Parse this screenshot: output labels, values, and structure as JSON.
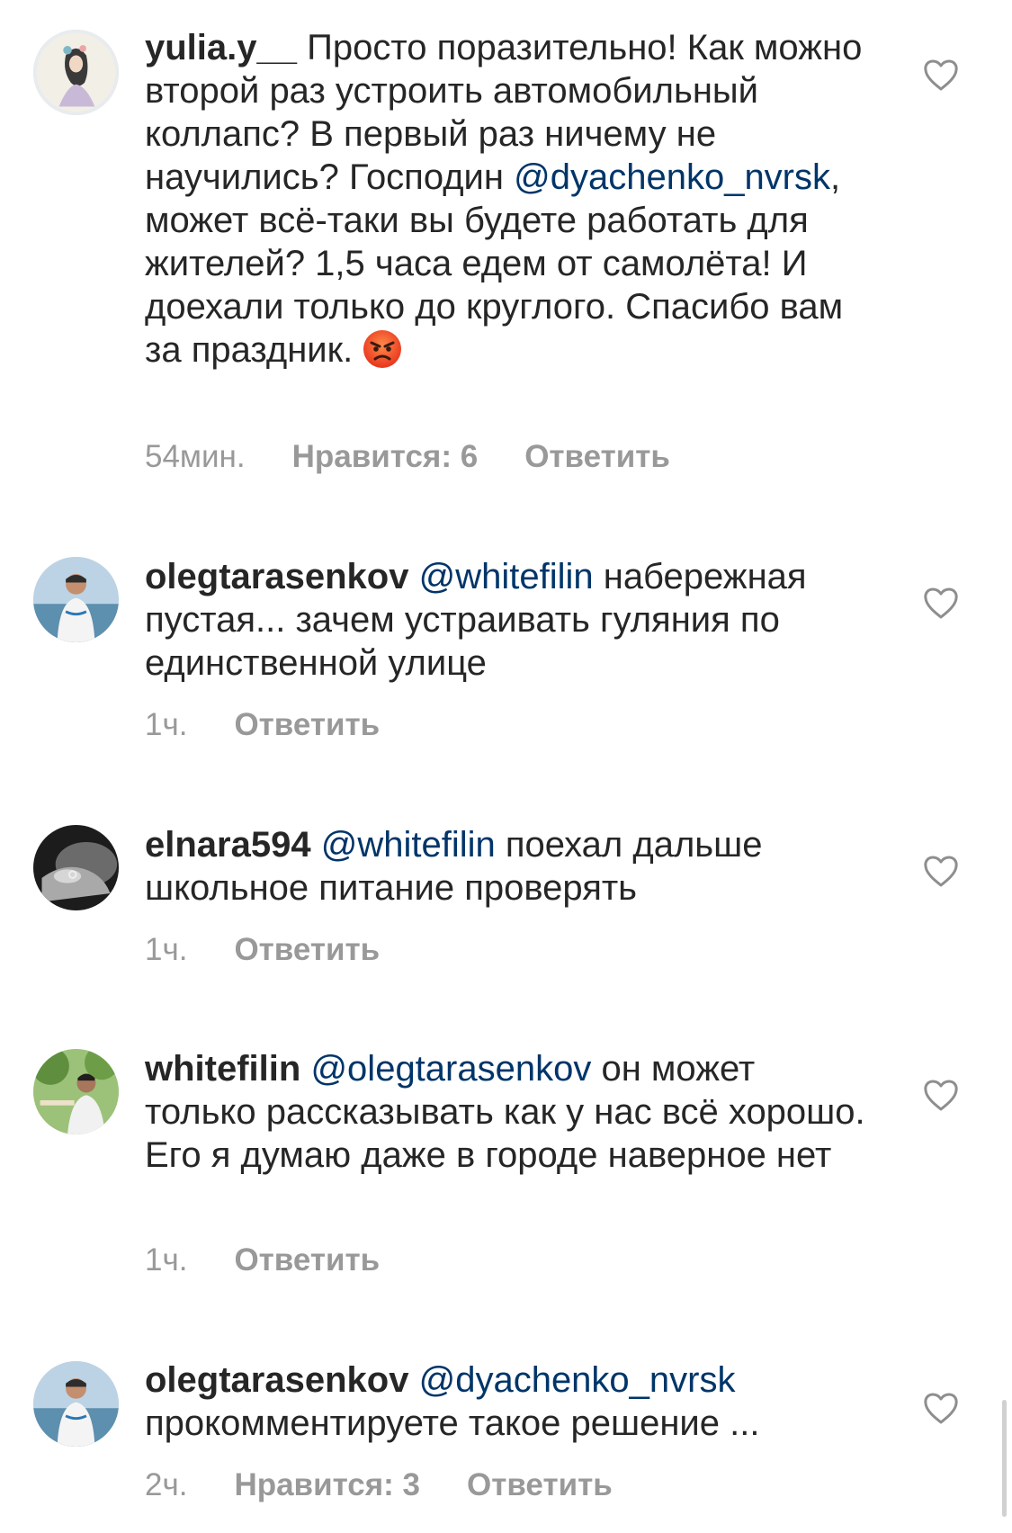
{
  "comments": [
    {
      "username": "yulia.y__",
      "text_before": " Просто поразительно! Как можно второй раз устроить автомобильный коллапс? В первый раз ничему не научились? Господин ",
      "mention": "@dyachenko_nvrsk",
      "text_after": ", может всё-таки вы будете работать для жителей? 1,5 часа едем от самолёта! И доехали только до круглого. Спасибо вам за праздник.",
      "emoji": "angry-face",
      "time": "54мин.",
      "likes": "Нравится: 6",
      "reply": "Ответить"
    },
    {
      "username": "olegtarasenkov",
      "text_before": " ",
      "mention": "@whitefilin",
      "text_after": " набережная пустая... зачем устраивать гуляния по единственной улице",
      "time": "1ч.",
      "likes": "",
      "reply": "Ответить"
    },
    {
      "username": "elnara594",
      "text_before": " ",
      "mention": "@whitefilin",
      "text_after": " поехал дальше школьное питание проверять",
      "time": "1ч.",
      "likes": "",
      "reply": "Ответить"
    },
    {
      "username": "whitefilin",
      "text_before": " ",
      "mention": "@olegtarasenkov",
      "text_after": " он может только рассказывать как у нас всё хорошо. Его я думаю даже в городе наверное нет",
      "time": "1ч.",
      "likes": "",
      "reply": "Ответить"
    },
    {
      "username": "olegtarasenkov",
      "text_before": " ",
      "mention": "@dyachenko_nvrsk",
      "text_after": " прокомментируете такое решение ...",
      "time": "2ч.",
      "likes": "Нравится: 3",
      "reply": "Ответить"
    }
  ],
  "icons": {
    "like": "heart-outline-icon",
    "emoji": "angry-face-emoji"
  },
  "colors": {
    "text": "#262626",
    "mention": "#003569",
    "meta": "#999999",
    "heart": "#8e8e8e"
  }
}
